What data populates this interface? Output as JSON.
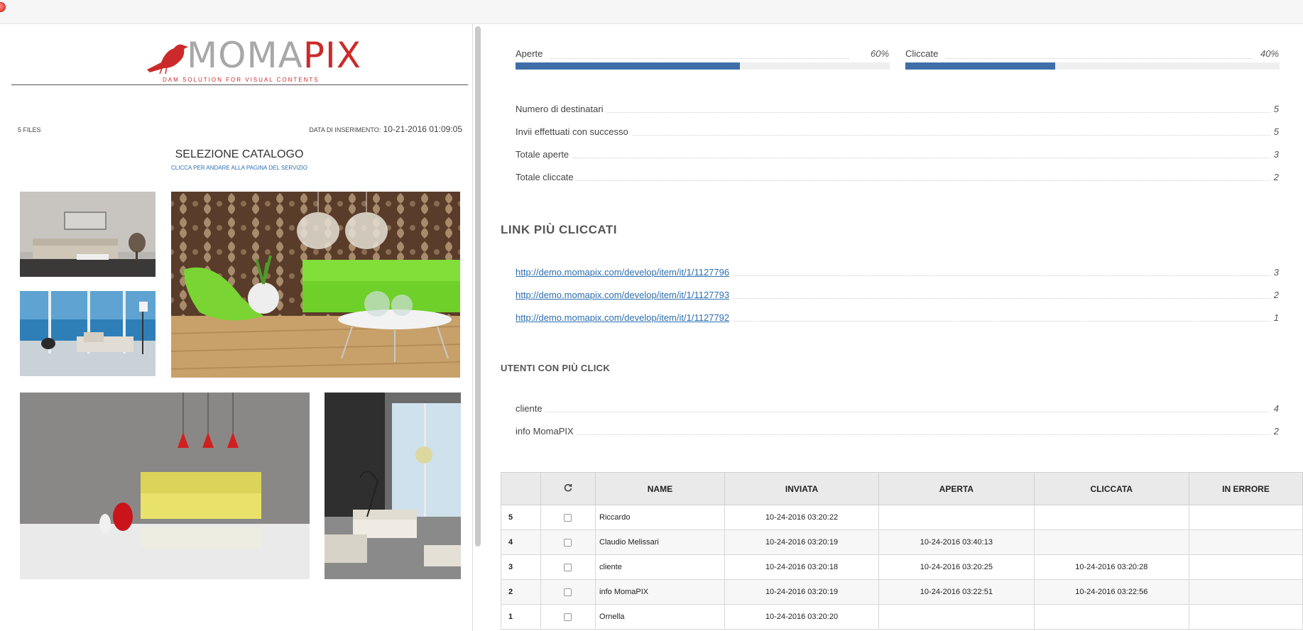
{
  "email": {
    "logo": {
      "word_grey": "MOMA",
      "word_red": "PIX",
      "tagline": "DAM SOLUTION FOR VISUAL CONTENTS"
    },
    "files_count": "5 files",
    "data_label": "Data di inserimento:",
    "data_value": "10-21-2016 01:09:05",
    "catalog_title": "SELEZIONE CATALOGO",
    "catalog_link": "clicca per andare alla pagina del servizio",
    "images": [
      "living-room-grey-sofa",
      "living-room-sea-view",
      "green-sofa-living-room",
      "yellow-sofa-red-lamps",
      "modern-living-room-window"
    ]
  },
  "bars": [
    {
      "label": "Aperte",
      "pct_text": "60%",
      "value": 0.6
    },
    {
      "label": "Cliccate",
      "pct_text": "40%",
      "value": 0.4
    }
  ],
  "stats": [
    {
      "label": "Numero di destinatari",
      "value": "5"
    },
    {
      "label": "Invii effettuati con successo",
      "value": "5"
    },
    {
      "label": "Totale aperte",
      "value": "3"
    },
    {
      "label": "Totale cliccate",
      "value": "2"
    }
  ],
  "links_title": "LINK PIÙ CLICCATI",
  "links": [
    {
      "url": "http://demo.momapix.com/develop/item/it/1/1127796",
      "count": "3"
    },
    {
      "url": "http://demo.momapix.com/develop/item/it/1/1127793",
      "count": "2"
    },
    {
      "url": "http://demo.momapix.com/develop/item/it/1/1127792",
      "count": "1"
    }
  ],
  "users_title": "UTENTI CON PIÙ CLICK",
  "users": [
    {
      "name": "cliente",
      "count": "4"
    },
    {
      "name": "info MomaPIX",
      "count": "2"
    }
  ],
  "table": {
    "headers": [
      "",
      "refresh-icon",
      "NAME",
      "INVIATA",
      "APERTA",
      "CLICCATA",
      "IN ERRORE"
    ],
    "rows": [
      {
        "num": "5",
        "name": "Riccardo",
        "inviata": "10-24-2016 03:20:22",
        "aperta": "",
        "cliccata": "",
        "errore": ""
      },
      {
        "num": "4",
        "name": "Claudio Melissari",
        "inviata": "10-24-2016 03:20:19",
        "aperta": "10-24-2016 03:40:13",
        "cliccata": "",
        "errore": ""
      },
      {
        "num": "3",
        "name": "cliente",
        "inviata": "10-24-2016 03:20:18",
        "aperta": "10-24-2016 03:20:25",
        "cliccata": "10-24-2016 03:20:28",
        "errore": ""
      },
      {
        "num": "2",
        "name": "info MomaPIX",
        "inviata": "10-24-2016 03:20:19",
        "aperta": "10-24-2016 03:22:51",
        "cliccata": "10-24-2016 03:22:56",
        "errore": ""
      },
      {
        "num": "1",
        "name": "Ornella",
        "inviata": "10-24-2016 03:20:20",
        "aperta": "",
        "cliccata": "",
        "errore": ""
      }
    ]
  },
  "colors": {
    "accent_blue": "#3e6ea8",
    "link_blue": "#2d6fb0",
    "brand_red": "#cc2a2a"
  }
}
